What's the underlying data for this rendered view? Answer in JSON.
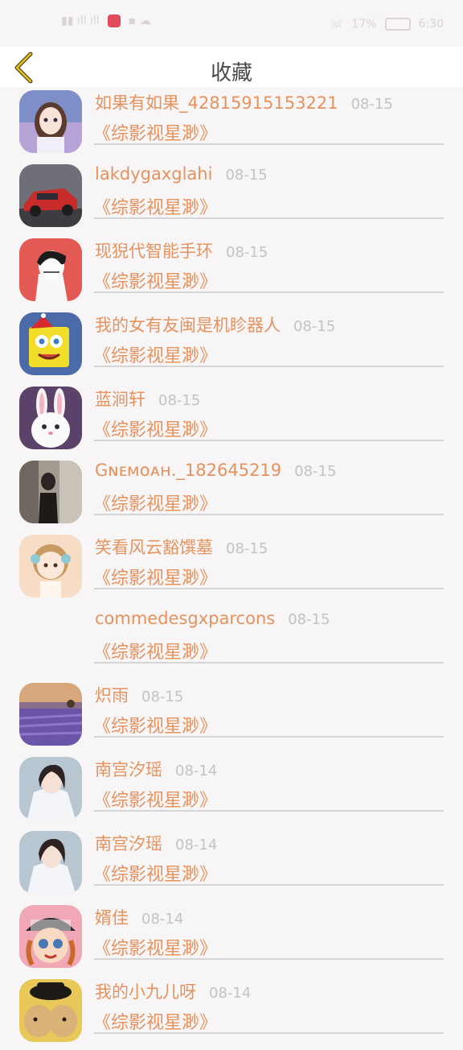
{
  "header": {
    "title": "收藏"
  },
  "status_bar": {
    "battery_percent": "17%",
    "time": "6:30"
  },
  "colors": {
    "accent": "#e4935f",
    "date_gray": "#c4c2c3",
    "back_arrow": "#c9a200"
  },
  "items": [
    {
      "name": "如果有如果_42815915153221",
      "date": "08-15",
      "book": "《综影视星渺》",
      "avatar": "anime-girl"
    },
    {
      "name": "lakdygaxglahi",
      "date": "08-15",
      "book": "《综影视星渺》",
      "avatar": "red-car"
    },
    {
      "name": "现猊代智能手环",
      "date": "08-15",
      "book": "《综影视星渺》",
      "avatar": "manga-boy"
    },
    {
      "name": "我的女有友闽是机眕器人",
      "date": "08-15",
      "book": "《综影视星渺》",
      "avatar": "spongebob"
    },
    {
      "name": "蓝涧轩",
      "date": "08-15",
      "book": "《综影视星渺》",
      "avatar": "white-rabbit"
    },
    {
      "name": "Gɴᴇᴍᴏᴀʜ._182645219",
      "date": "08-15",
      "book": "《综影视星渺》",
      "avatar": "dark-photo"
    },
    {
      "name": "笑看风云豁馔墓",
      "date": "08-15",
      "book": "《综影视星渺》",
      "avatar": "doll"
    },
    {
      "name": "commedesgxparcons",
      "date": "08-15",
      "book": "《综影视星渺》",
      "avatar": "none"
    },
    {
      "name": "炽雨",
      "date": "08-15",
      "book": "《综影视星渺》",
      "avatar": "lavender-field"
    },
    {
      "name": "南宫汐瑶",
      "date": "08-14",
      "book": "《综影视星渺》",
      "avatar": "girl-white-coat"
    },
    {
      "name": "南宫汐瑶",
      "date": "08-14",
      "book": "《综影视星渺》",
      "avatar": "girl-white-coat"
    },
    {
      "name": "婿佳",
      "date": "08-14",
      "book": "《综影视星渺》",
      "avatar": "cartoon-hat-girl"
    },
    {
      "name": "我的小九儿呀",
      "date": "08-14",
      "book": "《综影视星渺》",
      "avatar": "puppies"
    }
  ]
}
